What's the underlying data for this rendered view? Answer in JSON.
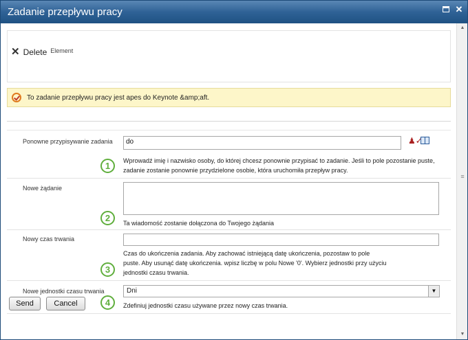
{
  "window": {
    "title": "Zadanie przepływu pracy",
    "maximize_icon": "maximize-icon",
    "close_icon": "close-icon"
  },
  "toolbar": {
    "delete_label": "Delete",
    "element_label": "Element",
    "delete_icon": "x-icon"
  },
  "notice": {
    "text": "To zadanie przepływu pracy jest apes do Keynote &amp;aft."
  },
  "fields": {
    "reassign": {
      "label": "Ponowne przypisywanie zadania",
      "value": "do",
      "badge": "1",
      "desc_lines": [
        "Wprowadź imię i nazwisko osoby, do której chcesz ponownie przypisać to zadanie. Jeśli to pole pozostanie puste,",
        "zadanie zostanie ponownie przydzielone osobie, która uruchomiła przepływ pracy."
      ]
    },
    "request": {
      "label": "Nowe żądanie",
      "value": "",
      "badge": "2",
      "desc_lines": [
        "Ta wiadomość zostanie dołączona do Twojego żądania"
      ]
    },
    "duration": {
      "label": "Nowy czas trwania",
      "value": "",
      "badge": "3",
      "desc_lines": [
        "Czas do ukończenia zadania. Aby zachować istniejącą datę ukończenia, pozostaw to pole",
        "puste. Aby usunąć datę ukończenia. wpisz liczbę w polu Nowe       '0'. Wybierz jednostki przy użyciu",
        "jednostki czasu trwania."
      ]
    },
    "units": {
      "label": "Nowe jednostki czasu trwania",
      "selected": "Dni",
      "badge": "4",
      "desc_lines": [
        "Zdefiniuj jednostki czasu używane przez nowy czas trwania."
      ]
    }
  },
  "buttons": {
    "send": "Send",
    "cancel": "Cancel"
  },
  "colors": {
    "titlebar": "#2f6296",
    "notice_bg": "#fdf6c9",
    "badge": "#5fae3c"
  }
}
